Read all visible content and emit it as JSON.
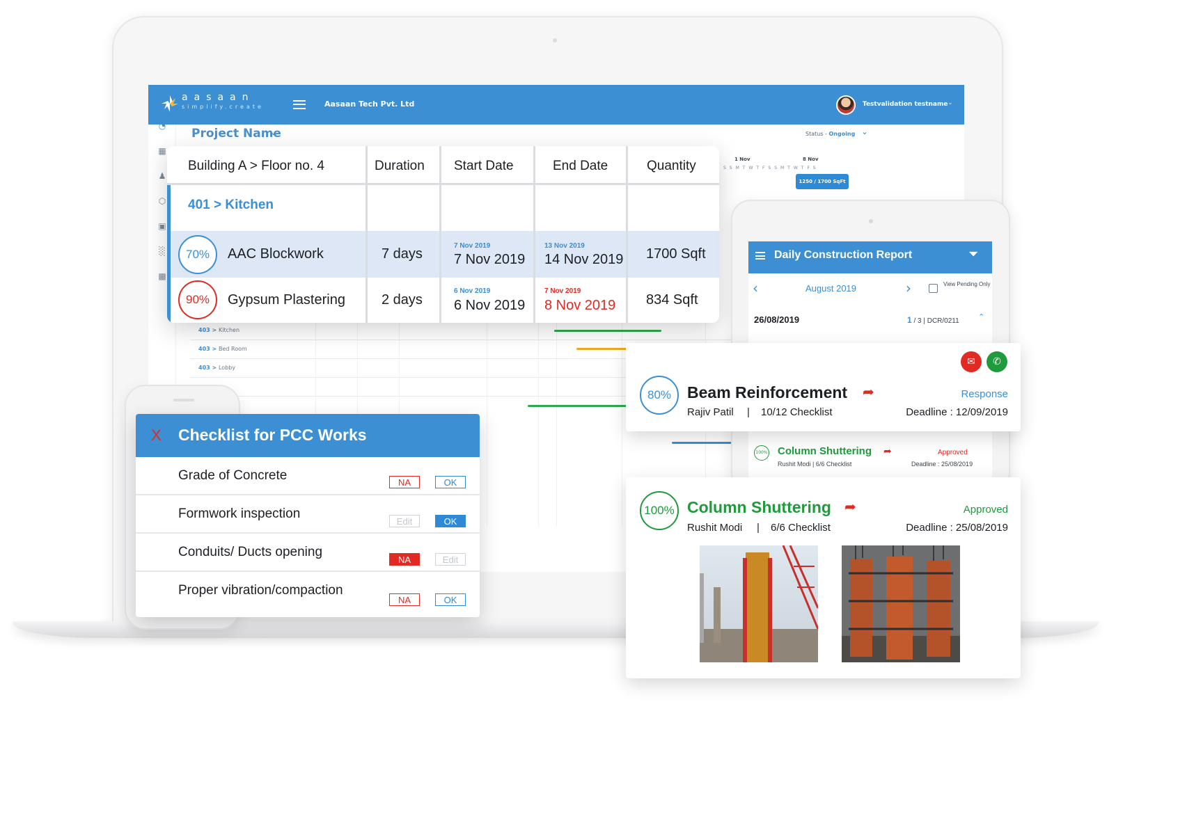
{
  "app": {
    "logo_text": "aasaan",
    "logo_tagline": "simplify.create",
    "company": "Aasaan Tech Pvt. Ltd",
    "user": "Testvalidation testname",
    "project_name": "Project Name",
    "status_label": "Status - ",
    "status_value": "Ongoing"
  },
  "gantt": {
    "weeks": [
      "1 Nov",
      "8 Nov"
    ],
    "days": "SSMTWTFSSMTWTFS",
    "tooltip": "1250 / 1700 SqFt",
    "rows": [
      {
        "unit": "403",
        "room": "Kitchen"
      },
      {
        "unit": "403",
        "room": "Bed Room"
      },
      {
        "unit": "403",
        "room": "Lobby"
      }
    ]
  },
  "table": {
    "headers": [
      "Building A > Floor no. 4",
      "Duration",
      "Start Date",
      "End Date",
      "Quantity"
    ],
    "group": "401 > Kitchen",
    "rows": [
      {
        "pct": "70%",
        "task": "AAC Blockwork",
        "duration": "7 days",
        "start_small": "7 Nov 2019",
        "start": "7 Nov 2019",
        "end_small": "13 Nov 2019",
        "end": "14 Nov 2019",
        "quantity": "1700 Sqft"
      },
      {
        "pct": "90%",
        "task": "Gypsum Plastering",
        "duration": "2 days",
        "start_small": "6 Nov 2019",
        "start": "6 Nov 2019",
        "end_small": "7 Nov 2019",
        "end": "8 Nov 2019",
        "quantity": "834 Sqft"
      }
    ],
    "colors": {
      "accent": "#3b8fd2",
      "late": "#e02a23",
      "ring_70": "#3b8fd2",
      "ring_90": "#e02a23"
    }
  },
  "checklist": {
    "close": "X",
    "title": "Checklist for PCC Works",
    "items": [
      {
        "label": "Grade of Concrete",
        "left": "NA",
        "right": "OK"
      },
      {
        "label": "Formwork inspection",
        "left": "Edit",
        "right": "OK"
      },
      {
        "label": "Conduits/ Ducts opening",
        "left": "NA",
        "right": "Edit"
      },
      {
        "label": "Proper vibration/compaction",
        "left": "NA",
        "right": "OK"
      }
    ]
  },
  "dcr": {
    "title": "Daily Construction Report",
    "month": "August 2019",
    "pending": "View Pending Only",
    "date": "26/08/2019",
    "page_current": "1",
    "page_rest": "/ 3  |  DCR/0211",
    "mini": {
      "pct": "100%",
      "title": "Column Shuttering",
      "status": "Approved",
      "meta": "Rushit Modi  |  6/6 Checklist",
      "deadline": "Deadline : 25/08/2019"
    }
  },
  "cards": [
    {
      "pct": "80%",
      "title": "Beam Reinforcement",
      "status": "Response",
      "person": "Rajiv Patil",
      "separator": "|",
      "checklist": "10/12 Checklist",
      "deadline": "Deadline : 12/09/2019",
      "title_color": "#1c1f23",
      "status_color": "#3b8fd2"
    },
    {
      "pct": "100%",
      "title": "Column Shuttering",
      "status": "Approved",
      "person": "Rushit Modi",
      "separator": "|",
      "checklist": "6/6 Checklist",
      "deadline": "Deadline : 25/08/2019",
      "title_color": "#1f9a3c",
      "status_color": "#1f9a3c"
    }
  ],
  "icons": {
    "mail": "mail-icon",
    "whatsapp": "whatsapp-icon",
    "share": "share-arrow-icon",
    "hamburger": "hamburger-icon",
    "filter": "filter-icon"
  }
}
